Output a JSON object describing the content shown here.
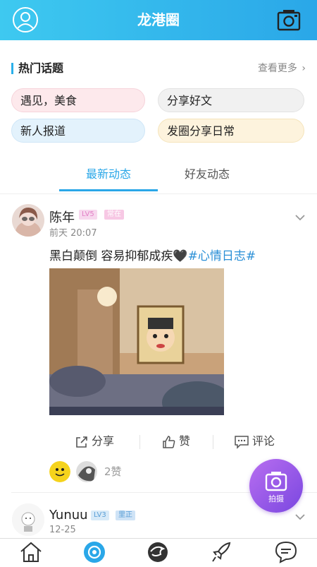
{
  "header": {
    "title": "龙港圈"
  },
  "hot_topics": {
    "heading": "热门话题",
    "more_label": "查看更多",
    "items": [
      {
        "label": "遇见，美食",
        "color": "#fde9ec"
      },
      {
        "label": "分享好文",
        "color": "#f1f1f1"
      },
      {
        "label": "新人报道",
        "color": "#e3f2fc"
      },
      {
        "label": "发圈分享日常",
        "color": "#fdf3dd"
      }
    ]
  },
  "tabs": [
    {
      "label": "最新动态",
      "active": true
    },
    {
      "label": "好友动态",
      "active": false
    }
  ],
  "posts": [
    {
      "username": "陈年",
      "level_badge": "LV5",
      "status_badge": "常在",
      "time": "前天 20:07",
      "text": "黑白颠倒 容易抑郁成疾🖤",
      "hashtag": "#心情日志#",
      "actions": {
        "share": "分享",
        "like": "赞",
        "comment": "评论"
      },
      "likes_count": "2赞"
    },
    {
      "username": "Yunuu",
      "level_badge": "LV3",
      "status_badge": "里正",
      "time": "12-25"
    }
  ],
  "fab": {
    "label": "拍摄"
  },
  "colors": {
    "primary": "#2aa7e8",
    "fab": "#9a5ae8",
    "hashtag": "#2a8fd6"
  },
  "bottom_nav": [
    "home-icon",
    "circle-icon",
    "dragon-icon",
    "rocket-icon",
    "message-icon"
  ]
}
